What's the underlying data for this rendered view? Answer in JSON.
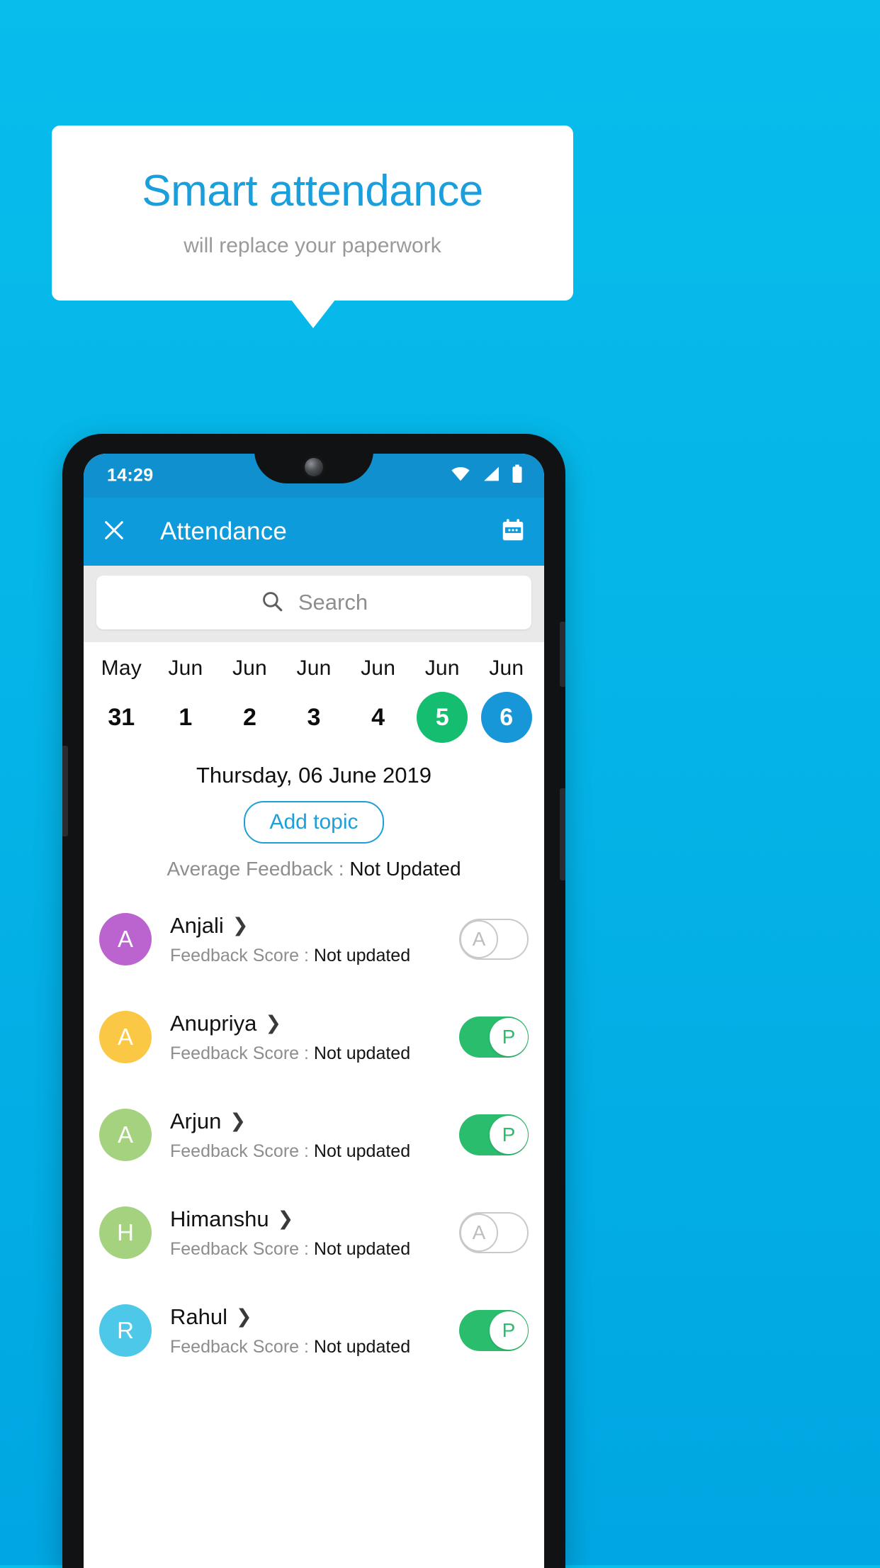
{
  "promo": {
    "title": "Smart attendance",
    "subtitle": "will replace your paperwork",
    "title_color": "#1a9fdc",
    "background_color": "#06bdec"
  },
  "phone": {
    "statusbar": {
      "time": "14:29",
      "icons": [
        "wifi-icon",
        "signal-icon",
        "battery-icon"
      ]
    },
    "appbar": {
      "close_icon": "close-icon",
      "title": "Attendance",
      "calendar_icon": "calendar-icon",
      "background_color": "#0d9bdb"
    },
    "search": {
      "placeholder": "Search",
      "icon": "search-icon"
    },
    "dates": [
      {
        "month": "May",
        "day": "31",
        "state": "normal"
      },
      {
        "month": "Jun",
        "day": "1",
        "state": "normal"
      },
      {
        "month": "Jun",
        "day": "2",
        "state": "normal"
      },
      {
        "month": "Jun",
        "day": "3",
        "state": "normal"
      },
      {
        "month": "Jun",
        "day": "4",
        "state": "normal"
      },
      {
        "month": "Jun",
        "day": "5",
        "state": "today"
      },
      {
        "month": "Jun",
        "day": "6",
        "state": "selected"
      }
    ],
    "day_header": "Thursday, 06 June 2019",
    "add_topic_label": "Add topic",
    "average_feedback": {
      "label": "Average Feedback : ",
      "value": "Not Updated"
    },
    "score_label": "Feedback Score : ",
    "students": [
      {
        "name": "Anjali",
        "initial": "A",
        "avatar_color": "#bb63ce",
        "score": "Not updated",
        "attendance": "A",
        "present": false
      },
      {
        "name": "Anupriya",
        "initial": "A",
        "avatar_color": "#fbc846",
        "score": "Not updated",
        "attendance": "P",
        "present": true
      },
      {
        "name": "Arjun",
        "initial": "A",
        "avatar_color": "#a4d27f",
        "score": "Not updated",
        "attendance": "P",
        "present": true
      },
      {
        "name": "Himanshu",
        "initial": "H",
        "avatar_color": "#a4d27f",
        "score": "Not updated",
        "attendance": "A",
        "present": false
      },
      {
        "name": "Rahul",
        "initial": "R",
        "avatar_color": "#4ec8e8",
        "score": "Not updated",
        "attendance": "P",
        "present": true
      }
    ],
    "colors": {
      "today_green": "#14bd6f",
      "selected_blue": "#1796d8",
      "present_green": "#2bbd6e",
      "accent_blue": "#1f9fd9"
    }
  }
}
